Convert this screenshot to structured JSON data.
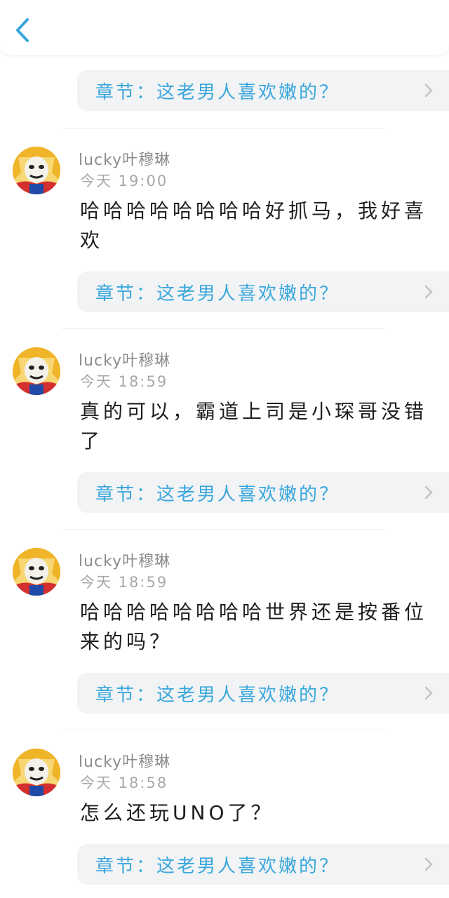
{
  "header": {
    "back_icon": "chevron-left-icon",
    "accent_color": "#3aa7dc"
  },
  "chapter_label": "章节：这老男人喜欢嫩的？",
  "comments": [
    {
      "username": "lucky叶穆琳",
      "time": "今天 19:00",
      "text": "哈哈哈哈哈哈哈哈好抓马，我好喜欢",
      "chapter": "章节：这老男人喜欢嫩的？"
    },
    {
      "username": "lucky叶穆琳",
      "time": "今天 18:59",
      "text": "真的可以，霸道上司是小琛哥没错了",
      "chapter": "章节：这老男人喜欢嫩的？"
    },
    {
      "username": "lucky叶穆琳",
      "time": "今天 18:59",
      "text": "哈哈哈哈哈哈哈哈世界还是按番位来的吗？",
      "chapter": "章节：这老男人喜欢嫩的？"
    },
    {
      "username": "lucky叶穆琳",
      "time": "今天 18:58",
      "text": "怎么还玩UNO了？",
      "chapter": "章节：这老男人喜欢嫩的？"
    }
  ]
}
